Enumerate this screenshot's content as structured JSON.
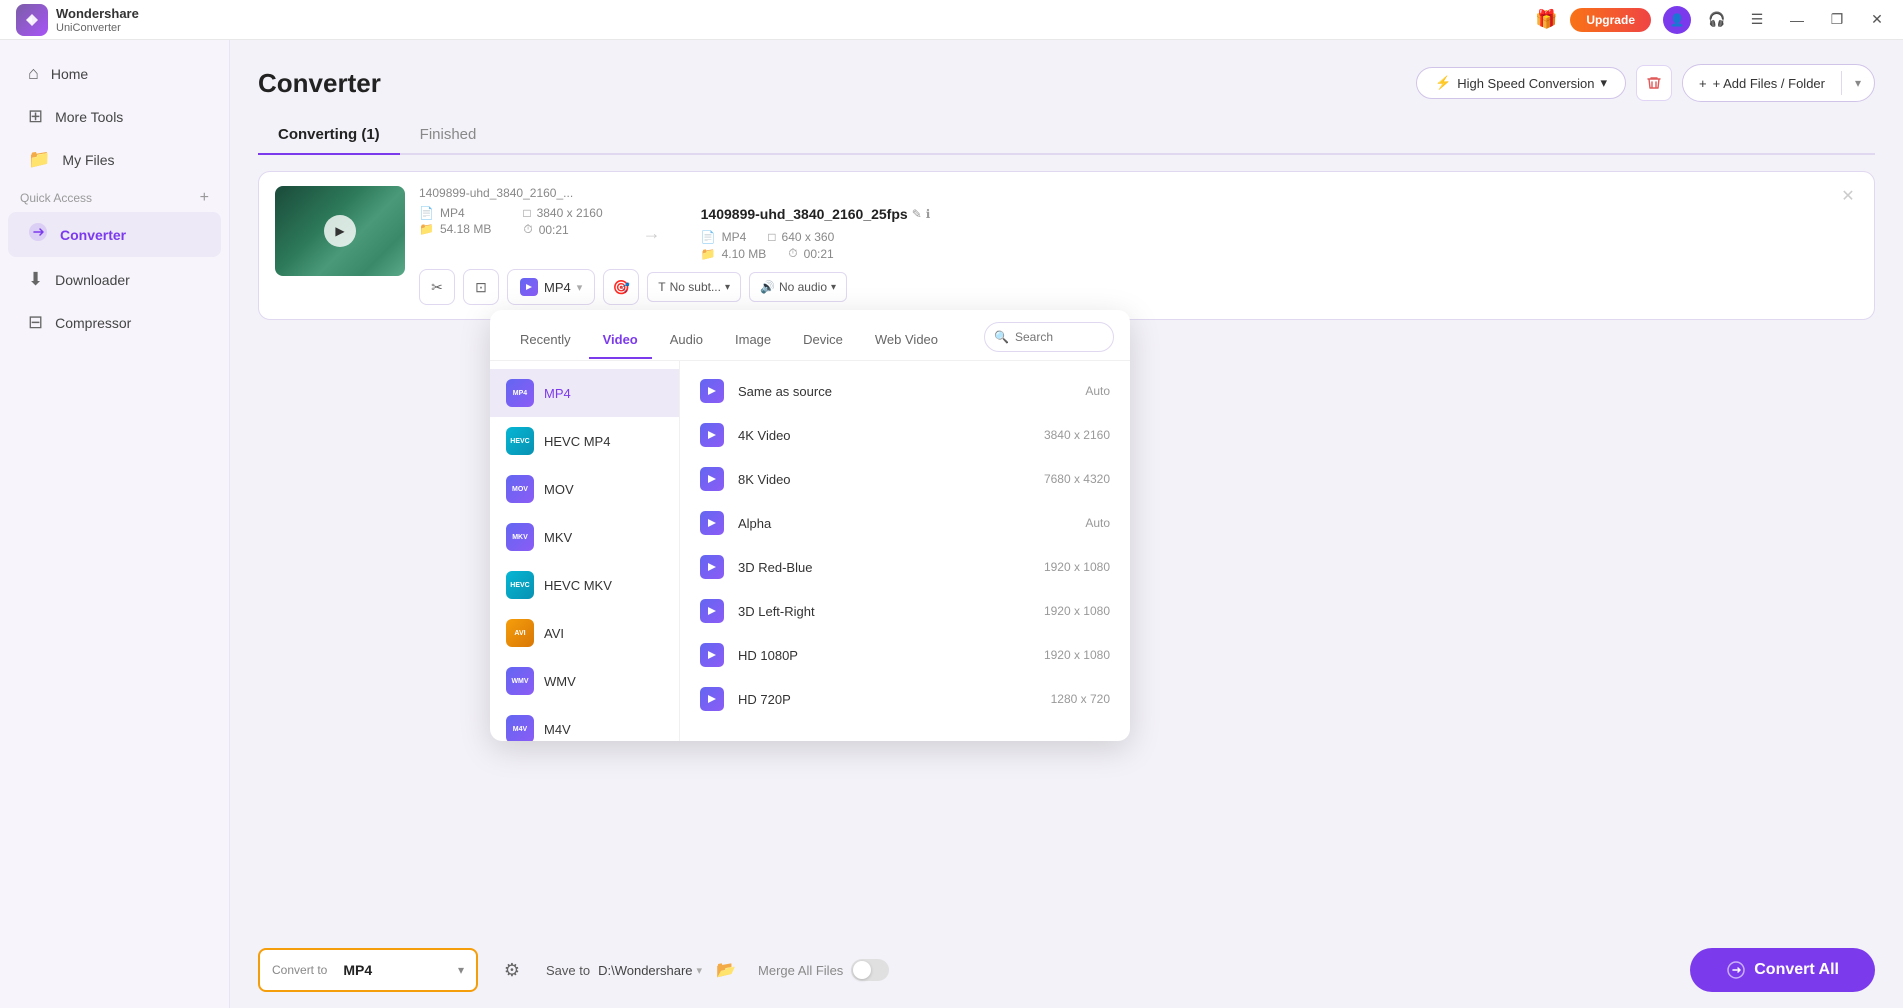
{
  "app": {
    "name": "Wondershare",
    "product": "UniConverter"
  },
  "titlebar": {
    "upgrade_label": "Upgrade",
    "min": "—",
    "restore": "❐",
    "close": "✕",
    "hamburger": "☰",
    "headset": "🎧"
  },
  "sidebar": {
    "items": [
      {
        "id": "home",
        "label": "Home",
        "icon": "⌂"
      },
      {
        "id": "more-tools",
        "label": "More Tools",
        "icon": "⊞"
      },
      {
        "id": "my-files",
        "label": "My Files",
        "icon": "📁"
      }
    ],
    "quick_access_label": "Quick Access",
    "active_item": {
      "id": "converter",
      "label": "Converter",
      "icon": "⇄"
    },
    "sub_items": [
      {
        "id": "downloader",
        "label": "Downloader",
        "icon": "⬇"
      },
      {
        "id": "compressor",
        "label": "Compressor",
        "icon": "⊟"
      }
    ]
  },
  "page": {
    "title": "Converter",
    "tabs": [
      {
        "id": "converting",
        "label": "Converting (1)",
        "active": true
      },
      {
        "id": "finished",
        "label": "Finished",
        "active": false
      }
    ],
    "high_speed_label": "High Speed Conversion",
    "add_files_label": "+ Add Files / Folder"
  },
  "file_item": {
    "filename_short": "1409899-uhd_3840_2160_...",
    "filename_full": "1409899-uhd_3840_2160_25fps",
    "source_format": "MP4",
    "source_size": "54.18 MB",
    "source_duration": "00:21",
    "source_resolution": "3840 x 2160",
    "target_format": "MP4",
    "target_size": "4.10 MB",
    "target_resolution": "640 x 360",
    "target_duration": "00:21",
    "subtitle_label": "No subt...",
    "audio_label": "No audio"
  },
  "bottom_toolbar": {
    "convert_to_label": "Convert to",
    "convert_to_value": "MP4",
    "save_to_label": "Save to",
    "save_path": "D:\\Wondershare",
    "merge_label": "Merge All Files",
    "convert_all_label": "Convert All"
  },
  "format_dropdown": {
    "tabs": [
      {
        "id": "recently",
        "label": "Recently"
      },
      {
        "id": "video",
        "label": "Video",
        "active": true
      },
      {
        "id": "audio",
        "label": "Audio"
      },
      {
        "id": "image",
        "label": "Image"
      },
      {
        "id": "device",
        "label": "Device"
      },
      {
        "id": "web-video",
        "label": "Web Video"
      }
    ],
    "search_placeholder": "Search",
    "formats": [
      {
        "id": "mp4",
        "label": "MP4",
        "color_class": "fi-mp4",
        "selected": true
      },
      {
        "id": "hevc-mp4",
        "label": "HEVC MP4",
        "color_class": "fi-hevc-mp4"
      },
      {
        "id": "mov",
        "label": "MOV",
        "color_class": "fi-mov"
      },
      {
        "id": "mkv",
        "label": "MKV",
        "color_class": "fi-mkv"
      },
      {
        "id": "hevc-mkv",
        "label": "HEVC MKV",
        "color_class": "fi-hevc-mkv"
      },
      {
        "id": "avi",
        "label": "AVI",
        "color_class": "fi-avi"
      },
      {
        "id": "wmv",
        "label": "WMV",
        "color_class": "fi-wmv"
      },
      {
        "id": "m4v",
        "label": "M4V",
        "color_class": "fi-m4v"
      }
    ],
    "options": [
      {
        "id": "same-as-source",
        "label": "Same as source",
        "resolution": "Auto"
      },
      {
        "id": "4k-video",
        "label": "4K Video",
        "resolution": "3840 x 2160"
      },
      {
        "id": "8k-video",
        "label": "8K Video",
        "resolution": "7680 x 4320"
      },
      {
        "id": "alpha",
        "label": "Alpha",
        "resolution": "Auto"
      },
      {
        "id": "3d-red-blue",
        "label": "3D Red-Blue",
        "resolution": "1920 x 1080"
      },
      {
        "id": "3d-left-right",
        "label": "3D Left-Right",
        "resolution": "1920 x 1080"
      },
      {
        "id": "hd-1080p",
        "label": "HD 1080P",
        "resolution": "1920 x 1080"
      },
      {
        "id": "hd-720p",
        "label": "HD 720P",
        "resolution": "1280 x 720"
      }
    ]
  }
}
